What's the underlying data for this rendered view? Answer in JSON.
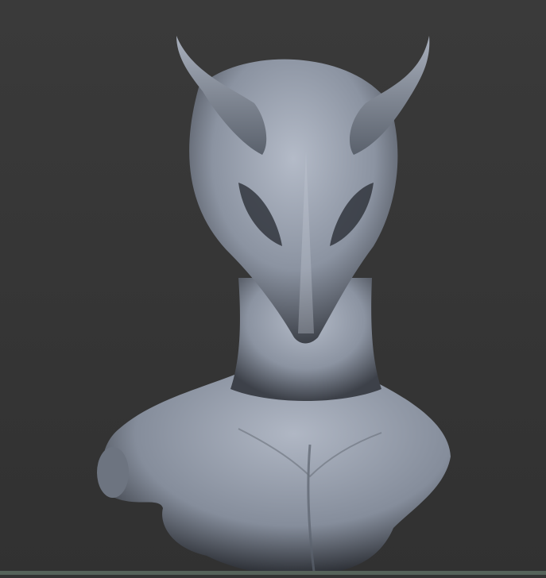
{
  "viewport": {
    "background_color": "#353535",
    "floor_line_color": "#56635a",
    "model_color": "#9aa2b0"
  }
}
